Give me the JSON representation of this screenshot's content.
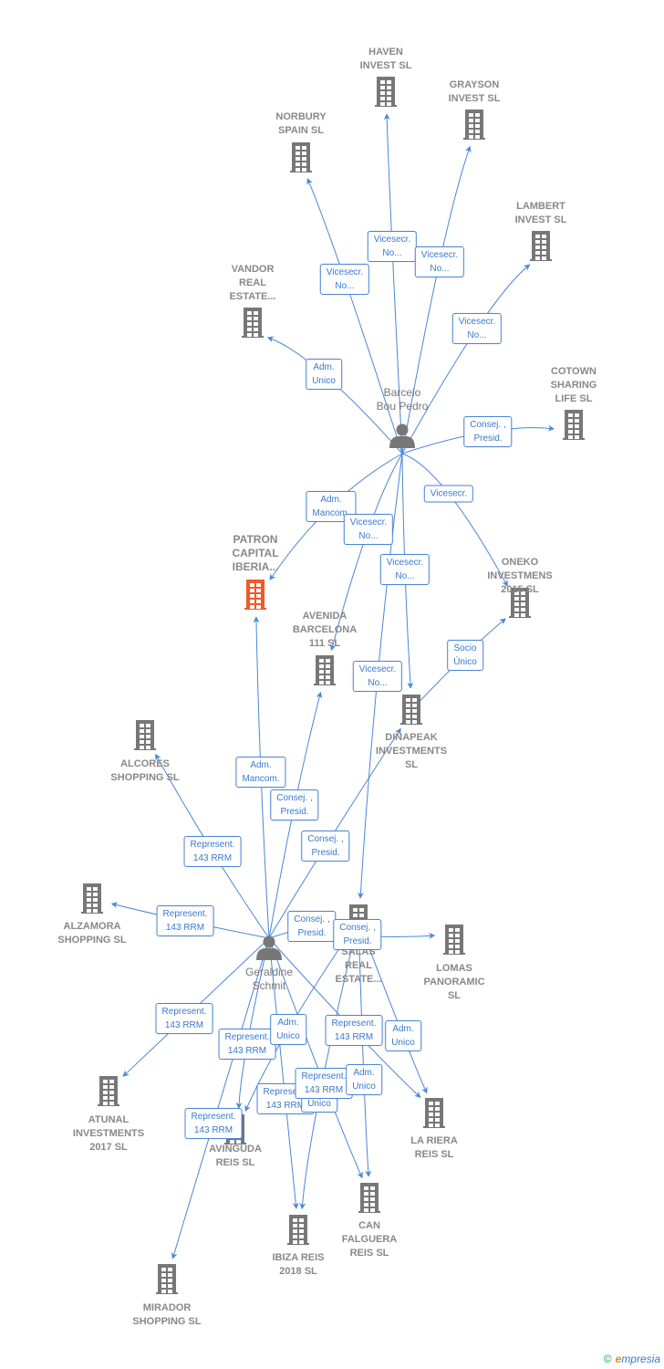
{
  "colors": {
    "edge": "#4a86d8",
    "company": "#777777",
    "highlight": "#f05a28",
    "person": "#777777"
  },
  "nodes": [
    {
      "id": "haven",
      "type": "company",
      "lines": [
        "HAVEN",
        "INVEST  SL"
      ]
    },
    {
      "id": "grayson",
      "type": "company",
      "lines": [
        "GRAYSON",
        "INVEST  SL"
      ]
    },
    {
      "id": "norbury",
      "type": "company",
      "lines": [
        "NORBURY",
        "SPAIN  SL"
      ]
    },
    {
      "id": "lambert",
      "type": "company",
      "lines": [
        "LAMBERT",
        "INVEST  SL"
      ]
    },
    {
      "id": "vandor",
      "type": "company",
      "lines": [
        "VANDOR",
        "REAL",
        "ESTATE..."
      ]
    },
    {
      "id": "cotown",
      "type": "company",
      "lines": [
        "COTOWN",
        "SHARING",
        "LIFE  SL"
      ]
    },
    {
      "id": "barcelo",
      "type": "person",
      "lines": [
        "Barcelo",
        "Bou Pedro"
      ]
    },
    {
      "id": "patron",
      "type": "main",
      "lines": [
        "PATRON",
        "CAPITAL",
        "IBERIA..."
      ]
    },
    {
      "id": "oneko",
      "type": "company",
      "lines": [
        "ONEKO",
        "INVESTMENS",
        "2015  SL"
      ]
    },
    {
      "id": "avenida",
      "type": "company",
      "lines": [
        "AVENIDA",
        "BARCELONA",
        "111 SL"
      ]
    },
    {
      "id": "dinapeak",
      "type": "company",
      "lines": [
        "DINAPEAK",
        "INVESTMENTS",
        "SL"
      ]
    },
    {
      "id": "alcores",
      "type": "company",
      "lines": [
        "ALCORES",
        "SHOPPING  SL"
      ]
    },
    {
      "id": "alzamora",
      "type": "company",
      "lines": [
        "ALZAMORA",
        "SHOPPING  SL"
      ]
    },
    {
      "id": "geraldine",
      "type": "person",
      "lines": [
        "Geraldine",
        "Schmit"
      ]
    },
    {
      "id": "salas",
      "type": "company",
      "lines": [
        "SALAS",
        "REAL",
        "ESTATE..."
      ]
    },
    {
      "id": "lomas",
      "type": "company",
      "lines": [
        "LOMAS",
        "PANORAMIC",
        "SL"
      ]
    },
    {
      "id": "atunal",
      "type": "company",
      "lines": [
        "ATUNAL",
        "INVESTMENTS",
        "2017  SL"
      ]
    },
    {
      "id": "avinguda",
      "type": "company",
      "lines": [
        "AVINGUDA",
        "REIS  SL"
      ]
    },
    {
      "id": "lariera",
      "type": "company",
      "lines": [
        "LA RIERA",
        "REIS  SL"
      ]
    },
    {
      "id": "ibiza",
      "type": "company",
      "lines": [
        "IBIZA REIS",
        "2018  SL"
      ]
    },
    {
      "id": "canfalguera",
      "type": "company",
      "lines": [
        "CAN",
        "FALGUERA",
        "REIS  SL"
      ]
    },
    {
      "id": "mirador",
      "type": "company",
      "lines": [
        "MIRADOR",
        "SHOPPING  SL"
      ]
    }
  ],
  "edges": [
    {
      "from": "barcelo",
      "to": "haven",
      "label": [
        "Vicesecr.",
        "No..."
      ]
    },
    {
      "from": "barcelo",
      "to": "grayson",
      "label": [
        "Vicesecr.",
        "No..."
      ]
    },
    {
      "from": "barcelo",
      "to": "norbury",
      "label": [
        "Vicesecr.",
        "No..."
      ]
    },
    {
      "from": "barcelo",
      "to": "lambert",
      "label": [
        "Vicesecr.",
        "No..."
      ]
    },
    {
      "from": "barcelo",
      "to": "vandor",
      "label": [
        "Adm.",
        "Unico"
      ]
    },
    {
      "from": "barcelo",
      "to": "cotown",
      "label": [
        "Consej. ,",
        "Presid."
      ]
    },
    {
      "from": "barcelo",
      "to": "patron",
      "label": [
        "Adm.",
        "Mancom."
      ]
    },
    {
      "from": "barcelo",
      "to": "avenida",
      "label": [
        "Vicesecr.",
        "No..."
      ]
    },
    {
      "from": "barcelo",
      "to": "oneko",
      "label": [
        "Vicesecr."
      ]
    },
    {
      "from": "barcelo",
      "to": "dinapeak",
      "label": [
        "Vicesecr.",
        "No..."
      ]
    },
    {
      "from": "dinapeak",
      "to": "oneko",
      "label": [
        "Socio",
        "Único"
      ]
    },
    {
      "from": "barcelo",
      "to": "salas",
      "label": [
        "Vicesecr.",
        "No..."
      ]
    },
    {
      "from": "geraldine",
      "to": "patron",
      "label": [
        "Adm.",
        "Mancom."
      ]
    },
    {
      "from": "geraldine",
      "to": "avenida",
      "label": [
        "Consej. ,",
        "Presid."
      ]
    },
    {
      "from": "geraldine",
      "to": "dinapeak",
      "label": [
        "Consej. ,",
        "Presid."
      ]
    },
    {
      "from": "geraldine",
      "to": "alcores",
      "label": [
        "Represent.",
        "143 RRM"
      ]
    },
    {
      "from": "geraldine",
      "to": "alzamora",
      "label": [
        "Represent.",
        "143 RRM"
      ]
    },
    {
      "from": "geraldine",
      "to": "salas",
      "label": [
        "Consej. ,",
        "Presid."
      ]
    },
    {
      "from": "salas",
      "to": "lomas",
      "label": [
        "Consej. ,",
        "Presid."
      ]
    },
    {
      "from": "geraldine",
      "to": "atunal",
      "label": [
        "Represent.",
        "143 RRM"
      ]
    },
    {
      "from": "geraldine",
      "to": "avinguda",
      "label": [
        "Represent.",
        "143 RRM"
      ]
    },
    {
      "from": "salas",
      "to": "avinguda",
      "label": [
        "Adm.",
        "Unico"
      ]
    },
    {
      "from": "geraldine",
      "to": "ibiza",
      "label": [
        "Represent.",
        "143 RRM"
      ]
    },
    {
      "from": "salas",
      "to": "ibiza",
      "label": [
        "Adm.",
        "Unico"
      ]
    },
    {
      "from": "geraldine",
      "to": "canfalguera",
      "label": [
        "Represent.",
        "143 RRM"
      ]
    },
    {
      "from": "geraldine",
      "to": "lariera",
      "label": [
        "Represent.",
        "143 RRM"
      ]
    },
    {
      "from": "salas",
      "to": "lariera",
      "label": [
        "Adm.",
        "Unico"
      ]
    },
    {
      "from": "salas",
      "to": "canfalguera",
      "label": [
        "Adm.",
        "Unico"
      ]
    },
    {
      "from": "geraldine",
      "to": "mirador",
      "label": [
        "Represent.",
        "143 RRM"
      ]
    }
  ],
  "footer": {
    "copyright": "©",
    "brand_initial": "e",
    "brand_rest": "mpresia"
  }
}
